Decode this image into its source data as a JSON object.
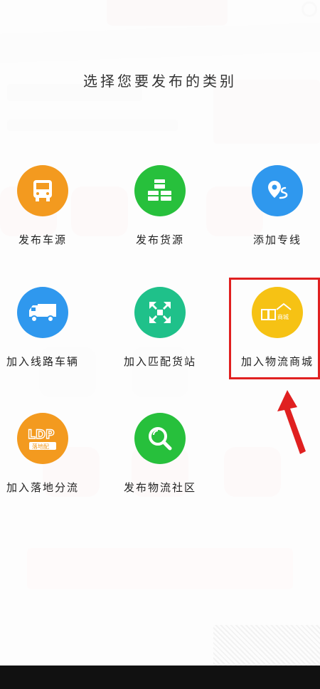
{
  "modal": {
    "title": "选择您要发布的类别"
  },
  "categories": [
    {
      "label": "发布车源",
      "icon": "truck-front-icon",
      "color": "#f39a1f"
    },
    {
      "label": "发布货源",
      "icon": "boxes-icon",
      "color": "#27c03c"
    },
    {
      "label": "添加专线",
      "icon": "route-pin-icon",
      "color": "#2f98ee"
    },
    {
      "label": "加入线路车辆",
      "icon": "truck-side-icon",
      "color": "#2f98ee"
    },
    {
      "label": "加入匹配货站",
      "icon": "match-arrows-icon",
      "color": "#1fc18a"
    },
    {
      "label": "加入物流商城",
      "icon": "mall-logo-icon",
      "color": "#f6c214",
      "badge": "商城"
    },
    {
      "label": "加入落地分流",
      "icon": "ldp-logo-icon",
      "color": "#f39a1f",
      "badge": "落地配"
    },
    {
      "label": "发布物流社区",
      "icon": "search-community-icon",
      "color": "#27c03c"
    }
  ],
  "annotation": {
    "highlight_color": "#e02020"
  }
}
